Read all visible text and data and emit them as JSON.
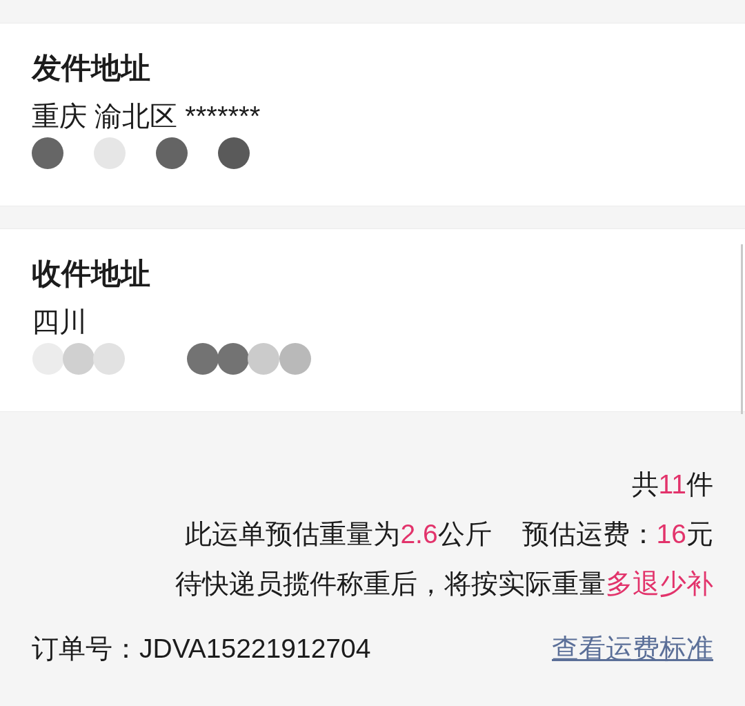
{
  "address_cards": [
    {
      "title": "发件地址",
      "address": "重庆 渝北区 *******"
    },
    {
      "title": "收件地址",
      "address": "四川"
    }
  ],
  "summary_lines": [
    {
      "texts": [
        [
          {
            "text": "共",
            "accent": false
          },
          {
            "text": "11",
            "accent": true
          },
          {
            "text": "件",
            "accent": false
          }
        ]
      ]
    },
    {
      "texts": [
        [
          {
            "text": "此运单预估重量为",
            "accent": false
          },
          {
            "text": "2.6",
            "accent": true
          },
          {
            "text": "公斤",
            "accent": false
          }
        ],
        [
          {
            "text": "预估运费：",
            "accent": false
          },
          {
            "text": "16",
            "accent": true
          },
          {
            "text": "元",
            "accent": false
          }
        ]
      ]
    },
    {
      "texts": [
        [
          {
            "text": "待快递员揽件称重后，将按实际重量",
            "accent": false
          },
          {
            "text": "多退少补",
            "accent": true
          }
        ]
      ]
    }
  ],
  "order": {
    "number": "订单号：JDVA15221912704",
    "link": "查看运费标准"
  }
}
